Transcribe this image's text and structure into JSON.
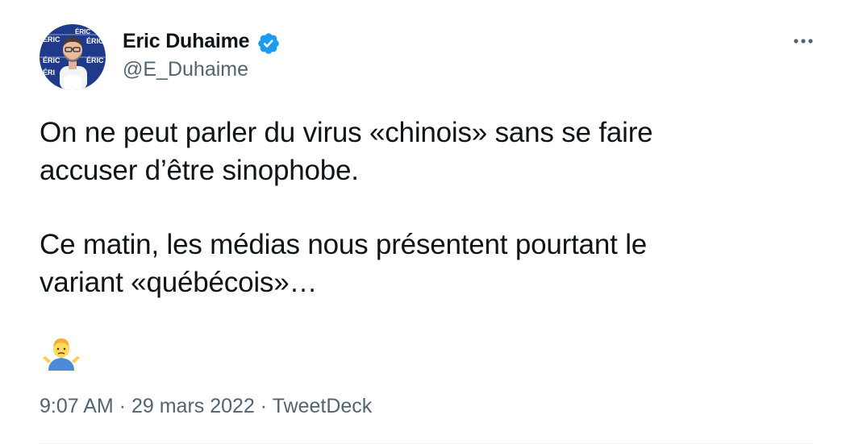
{
  "author": {
    "name": "Eric Duhaime",
    "handle": "@E_Duhaime",
    "verified": true,
    "avatar_backdrop_text": "ÉRIC DUHAIME"
  },
  "icons": {
    "verified": "verified-badge-icon",
    "more": "more-options-icon",
    "emoji": "person-shrugging-emoji"
  },
  "tweet": {
    "paragraphs": [
      "On ne peut parler du virus «chinois» sans se faire\naccuser d’être sinophobe.",
      "Ce matin, les médias nous présentent pourtant le\nvariant «québécois»…"
    ]
  },
  "meta": {
    "time": "9:07 AM",
    "separator": "·",
    "date": "29 mars 2022",
    "source": "TweetDeck"
  },
  "colors": {
    "text": "#0f1419",
    "secondary": "#536471",
    "verified": "#1d9bf0",
    "avatar_backdrop": "#1f3a8a"
  }
}
